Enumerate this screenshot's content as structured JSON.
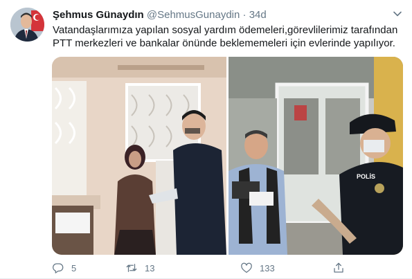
{
  "tweet": {
    "author_name": "Şehmus Günaydın",
    "author_handle": "@SehmusGunaydin",
    "separator": "·",
    "time": "34d",
    "text": "Vatandaşlarımıza yapılan sosyal yardım ödemeleri,görevlilerimiz tarafından PTT merkezleri ve bankalar önünde beklememeleri için evlerinde yapılıyor.",
    "more_icon": "chevron-down-icon"
  },
  "media": {
    "photo_1_icon": "photo",
    "photo_2_icon": "photo",
    "photo_2_badge": "POLİS"
  },
  "actions": {
    "reply_count": "5",
    "retweet_count": "13",
    "like_count": "133",
    "icons": [
      "reply-icon",
      "retweet-icon",
      "like-icon",
      "share-icon"
    ]
  },
  "colors": {
    "text": "#14171a",
    "secondary": "#657786",
    "border": "#e6ecf0"
  }
}
